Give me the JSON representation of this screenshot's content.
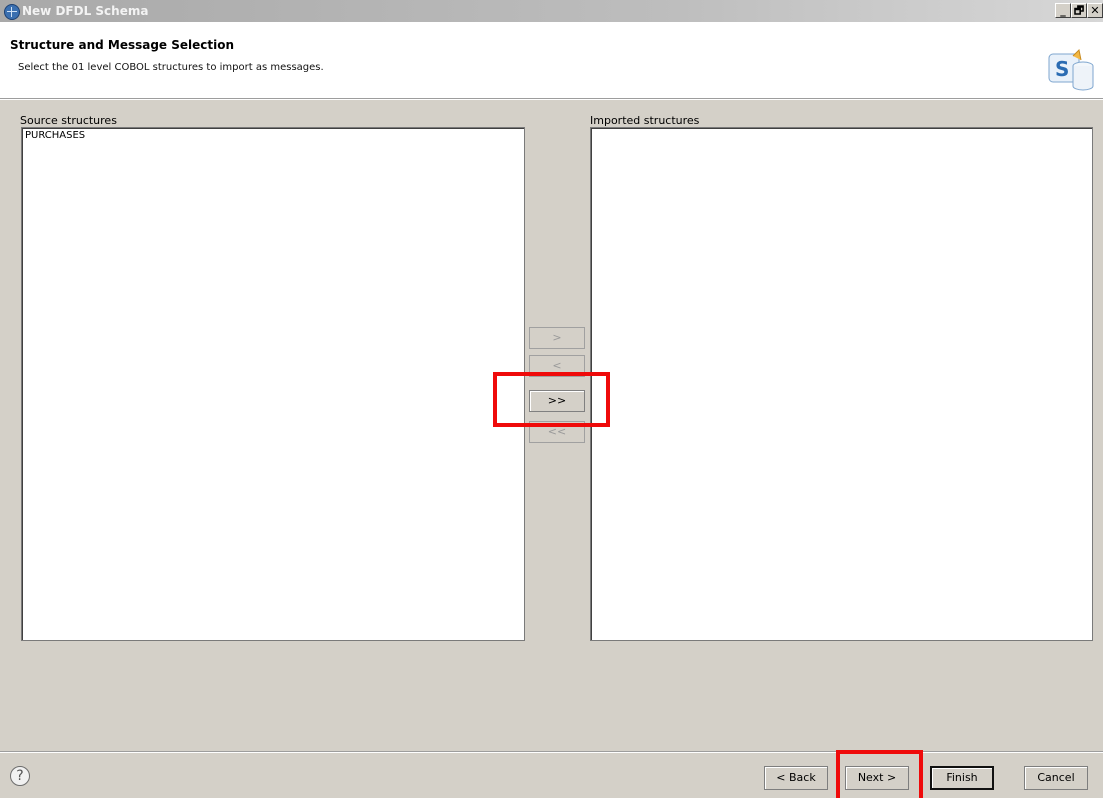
{
  "window": {
    "title": "New DFDL Schema",
    "controls": [
      "_",
      "🗗",
      "✕"
    ]
  },
  "banner": {
    "heading": "Structure and Message Selection",
    "description": "Select the 01 level COBOL structures to import as messages."
  },
  "source": {
    "label": "Source structures",
    "items": [
      "PURCHASES"
    ]
  },
  "imported": {
    "label": "Imported structures",
    "items": []
  },
  "move_buttons": {
    "add": ">",
    "remove": "<",
    "add_all": ">>",
    "remove_all": "<<"
  },
  "footer": {
    "help": "?",
    "back": "< Back",
    "next": "Next >",
    "finish": "Finish",
    "cancel": "Cancel"
  },
  "colors": {
    "highlight": "#ef0a0a",
    "dialog_bg": "#d4d0c8"
  }
}
